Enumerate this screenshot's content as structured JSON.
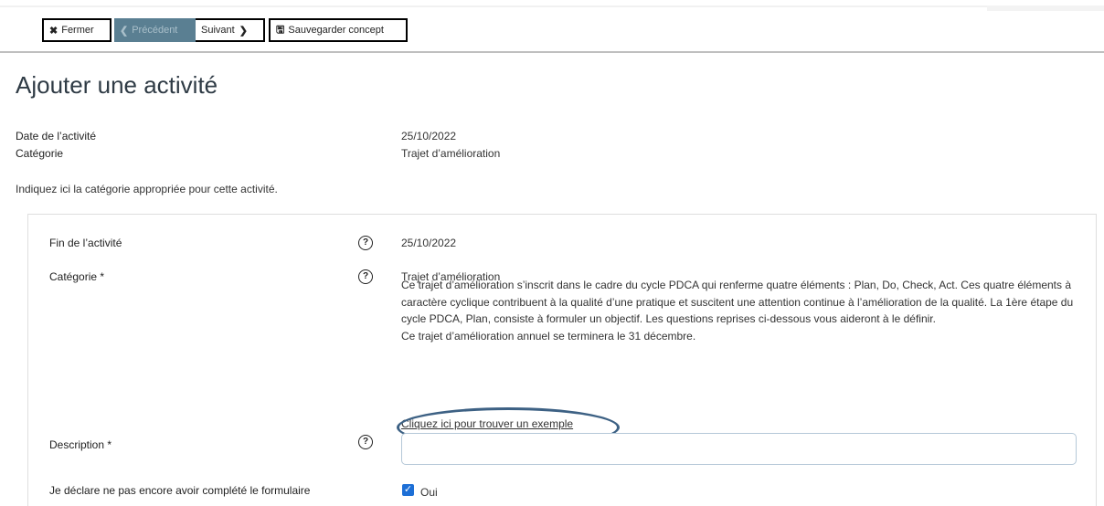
{
  "toolbar": {
    "close_icon": "✖",
    "close_label": "Fermer",
    "prev_icon": "❮",
    "prev_label": "Précédent",
    "next_label": "Suivant",
    "next_icon": "❯",
    "save_icon": "🖫",
    "save_label": "Sauvegarder concept"
  },
  "page": {
    "title": "Ajouter une activité"
  },
  "summary": {
    "date_label": "Date de l’activité",
    "date_value": "25/10/2022",
    "category_label": "Catégorie",
    "category_value": "Trajet d’amélioration",
    "hint": "Indiquez ici la catégorie appropriée pour cette activité."
  },
  "form": {
    "end_label": "Fin de l’activité",
    "end_value": "25/10/2022",
    "category_label": "Catégorie *",
    "category_value": "Trajet d’amélioration",
    "category_description_1": "Ce trajet d’amélioration s’inscrit dans le cadre du cycle PDCA qui renferme quatre éléments : Plan, Do, Check, Act. Ces quatre éléments à caractère cyclique contribuent à la qualité d’une pratique et suscitent une attention continue à l’amélioration de la qualité. La 1ère étape du cycle PDCA, Plan, consiste à formuler un objectif. Les questions reprises ci-dessous vous aideront à le définir.",
    "category_description_2": "Ce trajet d’amélioration annuel se terminera le 31 décembre.",
    "example_link": "Cliquez ici pour trouver un exemple",
    "description_label": "Description *",
    "description_value": "",
    "declare_label": "Je déclare ne pas encore avoir complété le formulaire",
    "declare_option": "Oui",
    "help_glyph": "?"
  }
}
